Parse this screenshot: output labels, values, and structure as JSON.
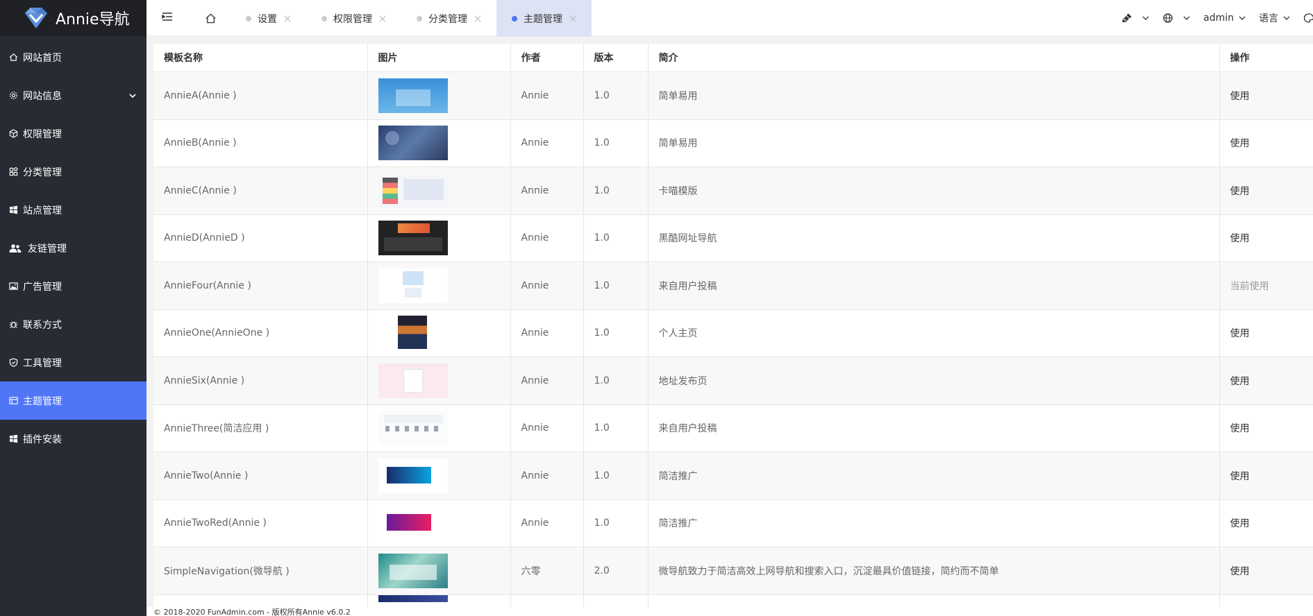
{
  "brand": {
    "name": "Annie导航",
    "logo_icon": "diamond-logo-icon",
    "accent": "#5076f7"
  },
  "sidebar": {
    "items": [
      {
        "label": "网站首页",
        "icon": "home-icon"
      },
      {
        "label": "网站信息",
        "icon": "gear-icon",
        "expandable": true
      },
      {
        "label": "权限管理",
        "icon": "cube-icon"
      },
      {
        "label": "分类管理",
        "icon": "apps-icon"
      },
      {
        "label": "站点管理",
        "icon": "windows-icon"
      },
      {
        "label": "友链管理",
        "icon": "users-icon"
      },
      {
        "label": "广告管理",
        "icon": "image-icon"
      },
      {
        "label": "联系方式",
        "icon": "bug-icon"
      },
      {
        "label": "工具管理",
        "icon": "shield-check-icon"
      },
      {
        "label": "主题管理",
        "icon": "table-icon",
        "active": true
      },
      {
        "label": "插件安装",
        "icon": "windows-icon"
      }
    ]
  },
  "topbar": {
    "tabs": [
      {
        "label": "设置"
      },
      {
        "label": "权限管理"
      },
      {
        "label": "分类管理"
      },
      {
        "label": "主题管理",
        "active": true
      }
    ],
    "user": "admin",
    "language": "语言"
  },
  "table": {
    "headers": [
      "模板名称",
      "图片",
      "作者",
      "版本",
      "简介",
      "操作"
    ],
    "rows": [
      {
        "name": "AnnieA(Annie )",
        "author": "Annie",
        "version": "1.0",
        "desc": "简单易用",
        "action": "使用"
      },
      {
        "name": "AnnieB(Annie )",
        "author": "Annie",
        "version": "1.0",
        "desc": "简单易用",
        "action": "使用"
      },
      {
        "name": "AnnieC(Annie )",
        "author": "Annie",
        "version": "1.0",
        "desc": "卡喵模版",
        "action": "使用"
      },
      {
        "name": "AnnieD(AnnieD )",
        "author": "Annie",
        "version": "1.0",
        "desc": "黑酷网址导航",
        "action": "使用"
      },
      {
        "name": "AnnieFour(Annie )",
        "author": "Annie",
        "version": "1.0",
        "desc": "来自用户投稿",
        "action": "当前使用"
      },
      {
        "name": "AnnieOne(AnnieOne )",
        "author": "Annie",
        "version": "1.0",
        "desc": "个人主页",
        "action": "使用"
      },
      {
        "name": "AnnieSix(Annie )",
        "author": "Annie",
        "version": "1.0",
        "desc": "地址发布页",
        "action": "使用"
      },
      {
        "name": "AnnieThree(简洁应用 )",
        "author": "Annie",
        "version": "1.0",
        "desc": "来自用户投稿",
        "action": "使用"
      },
      {
        "name": "AnnieTwo(Annie )",
        "author": "Annie",
        "version": "1.0",
        "desc": "简洁推广",
        "action": "使用"
      },
      {
        "name": "AnnieTwoRed(Annie )",
        "author": "Annie",
        "version": "1.0",
        "desc": "简洁推广",
        "action": "使用"
      },
      {
        "name": "SimpleNavigation(微导航 )",
        "author": "六零",
        "version": "2.0",
        "desc": "微导航致力于简洁高效上网导航和搜索入口，沉淀最具价值链接，简约而不简单",
        "action": "使用"
      }
    ]
  },
  "footer": {
    "text": "© 2018-2020 FunAdmin.com - 版权所有Annie v6.0.2"
  }
}
